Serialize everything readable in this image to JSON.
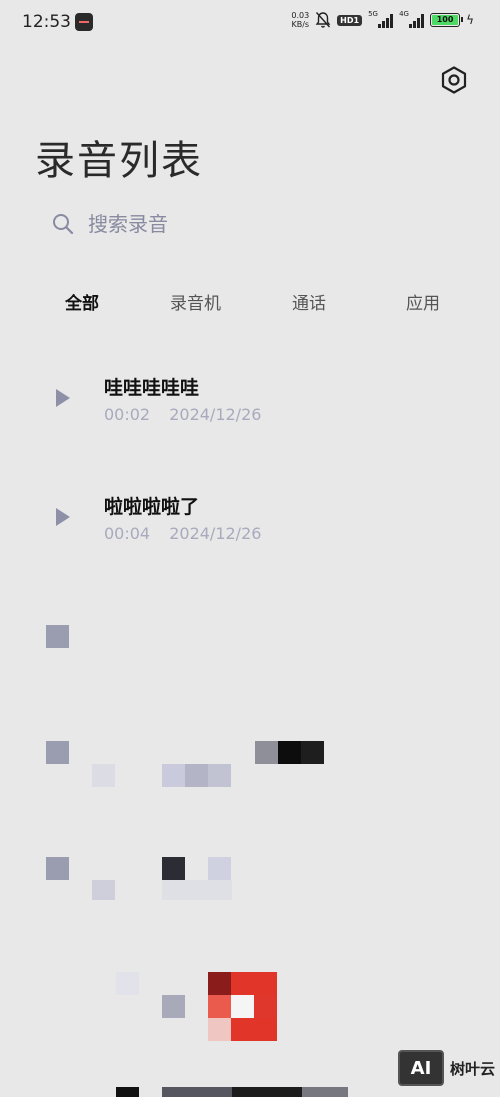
{
  "status_bar": {
    "time": "12:53",
    "net_speed_value": "0.03",
    "net_speed_unit": "KB/s",
    "hd_badge": "HD1",
    "signal1_label": "5G",
    "signal2_label": "4G",
    "battery": "100"
  },
  "header": {
    "title": "录音列表",
    "settings_icon": "gear-icon"
  },
  "search": {
    "placeholder": "搜索录音",
    "value": ""
  },
  "tabs": [
    {
      "label": "全部",
      "active": true
    },
    {
      "label": "录音机",
      "active": false
    },
    {
      "label": "通话",
      "active": false
    },
    {
      "label": "应用",
      "active": false
    }
  ],
  "recordings": [
    {
      "title": "哇哇哇哇哇",
      "duration": "00:02",
      "date": "2024/12/26"
    },
    {
      "title": "啦啦啦啦了",
      "duration": "00:04",
      "date": "2024/12/26"
    }
  ],
  "watermark": {
    "logo": "AI",
    "text": "树叶云"
  },
  "colors": {
    "background": "#e8e8e8",
    "meta_text": "#a8aabd",
    "battery_fill": "#4cd964"
  }
}
